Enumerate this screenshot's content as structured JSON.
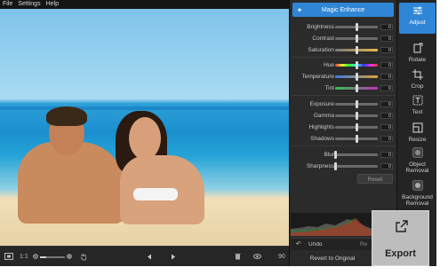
{
  "menu": [
    "File",
    "Settings",
    "Help"
  ],
  "adjust": {
    "magic_label": "Magic Enhance",
    "sliders": [
      {
        "label": "Brightness",
        "value": "0",
        "pos": 0.5,
        "track": "#6a6a6a"
      },
      {
        "label": "Contrast",
        "value": "0",
        "pos": 0.5,
        "track": "#6a6a6a"
      },
      {
        "label": "Saturation",
        "value": "0",
        "pos": 0.5,
        "track": "linear-gradient(to right,#777,#e8b94a)"
      },
      {
        "label": "Hue",
        "value": "0",
        "pos": 0.5,
        "track": "linear-gradient(to right,#e33,#ee3,#3e3,#3ee,#33e,#e3e,#e33)"
      },
      {
        "label": "Temperature",
        "value": "0",
        "pos": 0.5,
        "track": "linear-gradient(to right,#3b7be0,#e0a23b)"
      },
      {
        "label": "Tint",
        "value": "0",
        "pos": 0.5,
        "track": "linear-gradient(to right,#2ec44a,#c42ec0)"
      },
      {
        "label": "Exposure",
        "value": "0",
        "pos": 0.5,
        "track": "#6a6a6a"
      },
      {
        "label": "Gamma",
        "value": "0",
        "pos": 0.5,
        "track": "#6a6a6a"
      },
      {
        "label": "Highlights",
        "value": "0",
        "pos": 0.5,
        "track": "#6a6a6a"
      },
      {
        "label": "Shadows",
        "value": "0",
        "pos": 0.5,
        "track": "#6a6a6a"
      },
      {
        "label": "Blur",
        "value": "0",
        "pos": 0.0,
        "track": "#6a6a6a"
      },
      {
        "label": "Sharpness",
        "value": "0",
        "pos": 0.0,
        "track": "#6a6a6a"
      }
    ],
    "reset_label": "Reset",
    "undo_label": "Undo",
    "redo_label": "Re",
    "revert_label": "Revert to Original"
  },
  "tools": [
    {
      "label": "Adjust",
      "icon": "adjust-icon",
      "active": true
    },
    {
      "label": "Rotate",
      "icon": "rotate-icon",
      "active": false
    },
    {
      "label": "Crop",
      "icon": "crop-icon",
      "active": false
    },
    {
      "label": "Text",
      "icon": "text-icon",
      "active": false
    },
    {
      "label": "Resize",
      "icon": "resize-icon",
      "active": false
    },
    {
      "label": "Object Removal",
      "icon": "object-removal-icon",
      "active": false
    },
    {
      "label": "Background Removal",
      "icon": "background-removal-icon",
      "active": false
    }
  ],
  "export_label": "Export",
  "bottom": {
    "ratio_label": "1:1",
    "zoom_fraction": 0.25,
    "zoom_pct": "90"
  },
  "colors": {
    "accent": "#2f86d6",
    "panel": "#2b2b2b",
    "rail": "#242424"
  }
}
